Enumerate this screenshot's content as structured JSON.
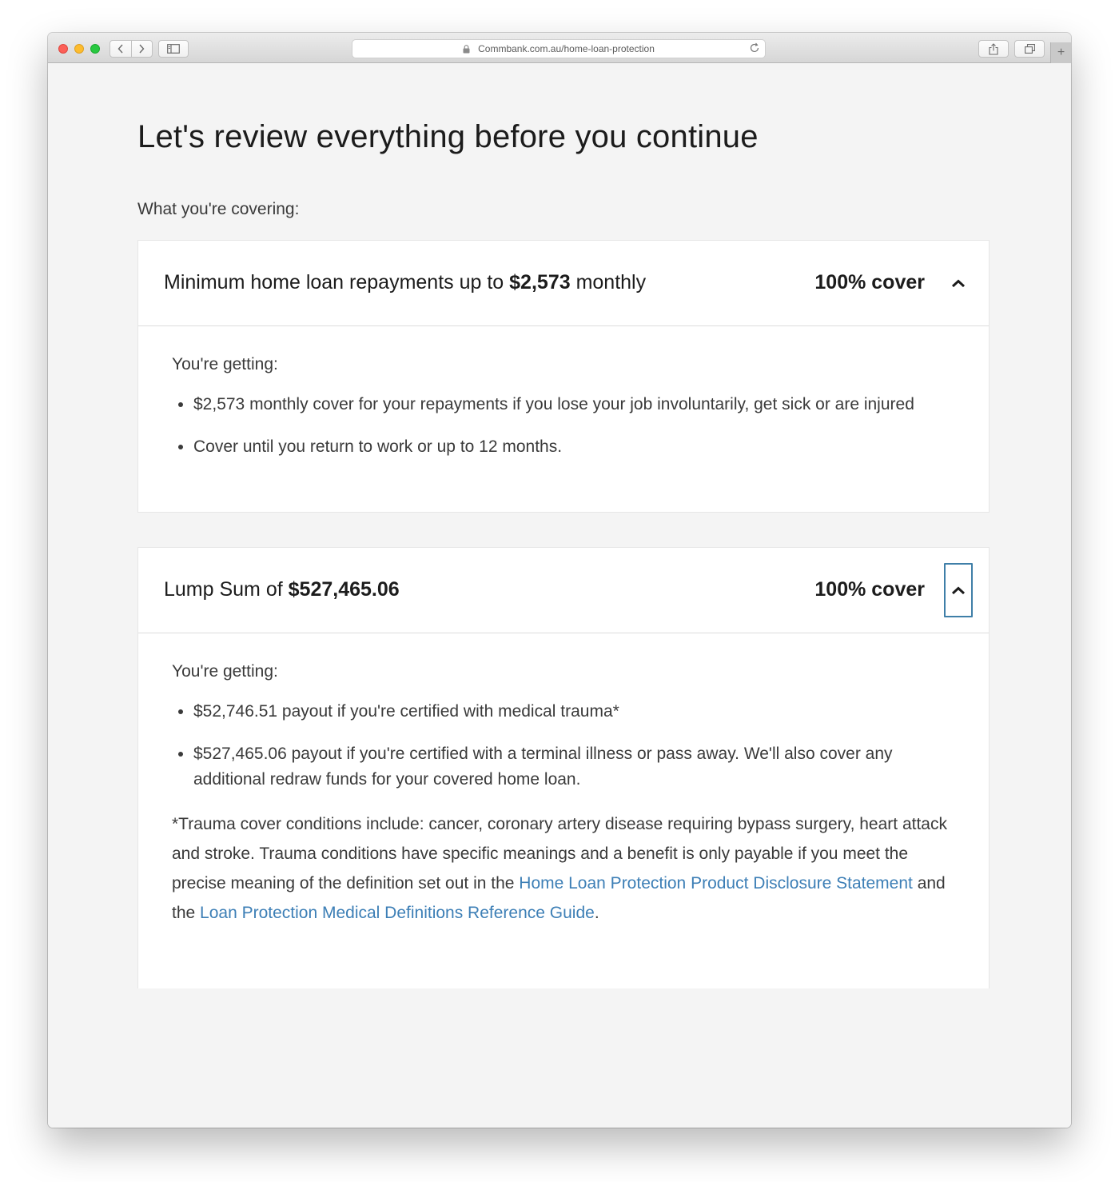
{
  "browser": {
    "url": "Commbank.com.au/home-loan-protection",
    "back_glyph": "‹",
    "forward_glyph": "›",
    "new_tab_glyph": "+"
  },
  "page": {
    "title": "Let's review everything before you continue",
    "covering_label": "What you're covering:"
  },
  "cards": [
    {
      "title_prefix": "Minimum home loan repayments up to ",
      "title_amount": "$2,573",
      "title_suffix": " monthly",
      "cover": "100% cover",
      "expanded": true,
      "getting_label": "You're getting:",
      "bullets": [
        "$2,573 monthly cover for your repayments if you lose your job involuntarily, get sick or are injured",
        "Cover until you return to work or up to 12 months."
      ]
    },
    {
      "title_prefix": "Lump Sum of ",
      "title_amount": "$527,465.06",
      "title_suffix": "",
      "cover": "100% cover",
      "expanded": true,
      "getting_label": "You're getting:",
      "bullets": [
        "$52,746.51 payout if you're certified with medical trauma*",
        "$527,465.06 payout if you're certified with a terminal illness or pass away. We'll also cover any additional redraw funds for your covered home loan."
      ],
      "note": {
        "text_1": "*Trauma cover conditions include: cancer, coronary artery disease requiring bypass surgery, heart attack and stroke. Trauma conditions have specific meanings and a benefit is only payable if you meet the precise meaning of the definition set out in the ",
        "link_1": "Home Loan Protection Product Disclosure Statement",
        "text_2": " and the ",
        "link_2": "Loan Protection Medical Definitions Reference Guide",
        "text_3": "."
      }
    }
  ],
  "colors": {
    "link": "#3d7fb6",
    "focus_ring": "#3f7fa8",
    "page_bg": "#f4f4f4"
  },
  "icons": {
    "toggle": "chevron-up-icon"
  }
}
